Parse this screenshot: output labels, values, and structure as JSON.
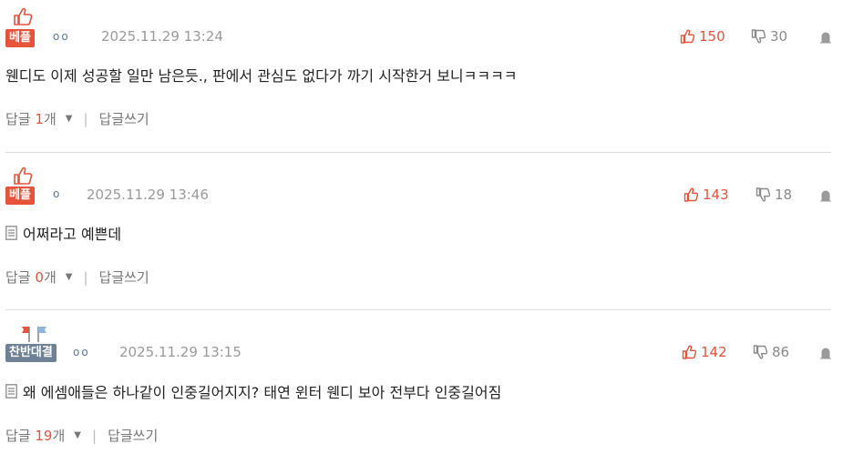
{
  "comments": [
    {
      "badge": "베플",
      "circles": "oo",
      "timestamp": "2025.11.29 13:24",
      "upvotes": "150",
      "downvotes": "30",
      "text": "웬디도 이제 성공할 일만 남은듯., 판에서 관심도 없다가 까기 시작한거 보니ㅋㅋㅋㅋ",
      "reply_label": "답글",
      "reply_count": "1",
      "reply_suffix": "개",
      "write_reply": "답글쓰기"
    },
    {
      "badge": "베플",
      "circles": "o",
      "timestamp": "2025.11.29 13:46",
      "upvotes": "143",
      "downvotes": "18",
      "text": "어쩌라고 예쁜데",
      "reply_label": "답글",
      "reply_count": "0",
      "reply_suffix": "개",
      "write_reply": "답글쓰기"
    },
    {
      "badge": "찬반대결",
      "circles": "oo",
      "timestamp": "2025.11.29 13:15",
      "upvotes": "142",
      "downvotes": "86",
      "text": "왜 에셈애들은 하나같이 인중길어지지? 태연 윈터 웬디 보아 전부다 인중길어짐",
      "reply_label": "답글",
      "reply_count": "19",
      "reply_suffix": "개",
      "write_reply": "답글쓰기"
    }
  ],
  "colors": {
    "accent": "#e5533b",
    "controversy": "#6f8295",
    "muted": "#9a9a9a"
  },
  "icons": {
    "thumbs_up": "thumbs-up-icon",
    "thumbs_down": "thumbs-down-icon",
    "report": "report-icon",
    "document": "document-icon",
    "flag": "flag-icon",
    "caret": "caret-down-icon"
  }
}
